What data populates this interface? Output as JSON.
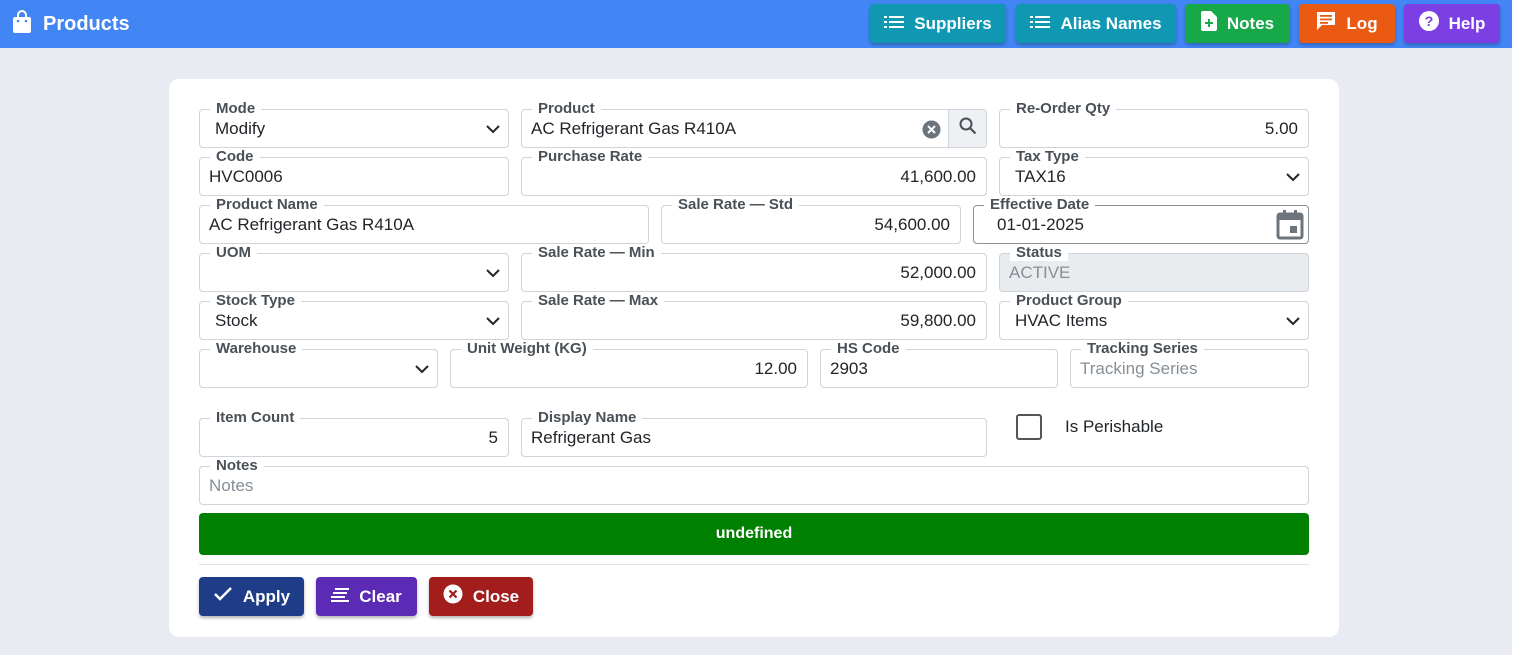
{
  "header": {
    "title": "Products",
    "buttons": {
      "suppliers": "Suppliers",
      "alias_names": "Alias Names",
      "notes": "Notes",
      "log": "Log",
      "help": "Help"
    }
  },
  "form": {
    "mode": {
      "label": "Mode",
      "value": "Modify"
    },
    "product": {
      "label": "Product",
      "value": "AC Refrigerant Gas R410A"
    },
    "reorder_qty": {
      "label": "Re-Order Qty",
      "value": "5.00"
    },
    "code": {
      "label": "Code",
      "value": "HVC0006"
    },
    "purchase_rate": {
      "label": "Purchase Rate",
      "value": "41,600.00"
    },
    "tax_type": {
      "label": "Tax Type",
      "value": "TAX16"
    },
    "product_name": {
      "label": "Product Name",
      "value": "AC Refrigerant Gas R410A"
    },
    "sale_rate_std": {
      "label": "Sale Rate — Std",
      "value": "54,600.00"
    },
    "effective_date": {
      "label": "Effective Date",
      "value": "01-01-2025"
    },
    "uom": {
      "label": "UOM",
      "value": ""
    },
    "sale_rate_min": {
      "label": "Sale Rate — Min",
      "value": "52,000.00"
    },
    "status": {
      "label": "Status",
      "value": "ACTIVE"
    },
    "stock_type": {
      "label": "Stock Type",
      "value": "Stock"
    },
    "sale_rate_max": {
      "label": "Sale Rate — Max",
      "value": "59,800.00"
    },
    "product_group": {
      "label": "Product Group",
      "value": "HVAC Items"
    },
    "warehouse": {
      "label": "Warehouse",
      "value": ""
    },
    "unit_weight": {
      "label": "Unit Weight (KG)",
      "value": "12.00"
    },
    "hs_code": {
      "label": "HS Code",
      "value": "2903"
    },
    "tracking_series": {
      "label": "Tracking Series",
      "placeholder": "Tracking Series"
    },
    "item_count": {
      "label": "Item Count",
      "value": "5"
    },
    "display_name": {
      "label": "Display Name",
      "value": "Refrigerant Gas"
    },
    "is_perishable": {
      "label": "Is Perishable",
      "checked": false
    },
    "notes": {
      "label": "Notes",
      "placeholder": "Notes"
    }
  },
  "status_bar": {
    "text": "undefined",
    "color": "#008000"
  },
  "actions": {
    "apply": "Apply",
    "clear": "Clear",
    "close": "Close"
  },
  "colors": {
    "header": "#4285f4",
    "suppliers": "#1097b1",
    "alias_names": "#1097b1",
    "notes": "#17a84a",
    "log": "#ea5a13",
    "help": "#7b3fe4",
    "apply": "#1f3c88",
    "clear": "#5b2bb5",
    "close": "#a31d1d"
  }
}
